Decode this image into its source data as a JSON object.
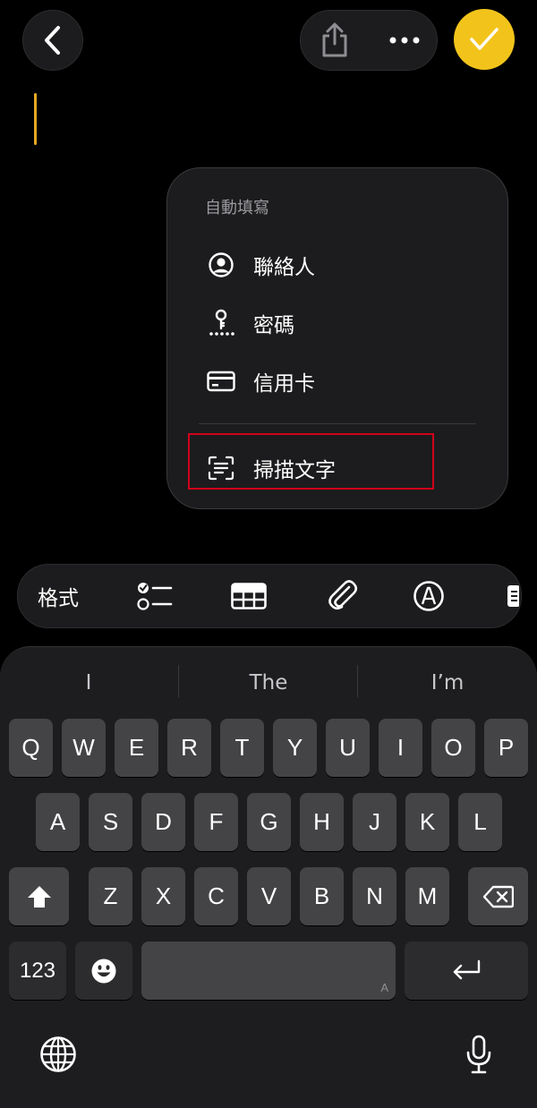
{
  "topbar": {
    "back_icon": "chevron-left-icon",
    "share_icon": "share-icon",
    "more_icon": "ellipsis-icon",
    "done_icon": "checkmark-icon",
    "done_color": "#f2c41b"
  },
  "autofill_menu": {
    "header": "自動填寫",
    "items": [
      {
        "label": "聯絡人",
        "icon": "person-circle-icon"
      },
      {
        "label": "密碼",
        "icon": "key-icon"
      },
      {
        "label": "信用卡",
        "icon": "credit-card-icon"
      },
      {
        "label": "掃描文字",
        "icon": "scan-text-icon"
      }
    ]
  },
  "format_toolbar": {
    "format_label": "格式",
    "items": [
      "checklist-icon",
      "table-icon",
      "paperclip-icon",
      "markup-icon",
      "more-icon"
    ]
  },
  "keyboard": {
    "suggestions": [
      "I",
      "The",
      "I’m"
    ],
    "row1": [
      "Q",
      "W",
      "E",
      "R",
      "T",
      "Y",
      "U",
      "I",
      "O",
      "P"
    ],
    "row2": [
      "A",
      "S",
      "D",
      "F",
      "G",
      "H",
      "J",
      "K",
      "L"
    ],
    "row3": [
      "Z",
      "X",
      "C",
      "V",
      "B",
      "N",
      "M"
    ],
    "numbers_label": "123",
    "space_sub": "A",
    "shift_icon": "shift-icon",
    "delete_icon": "delete-icon",
    "emoji_icon": "emoji-icon",
    "return_icon": "return-icon",
    "globe_icon": "globe-icon",
    "mic_icon": "microphone-icon"
  },
  "colors": {
    "accent": "#f2c41b",
    "cursor": "#e5a823",
    "highlight_border": "#d0021b"
  }
}
